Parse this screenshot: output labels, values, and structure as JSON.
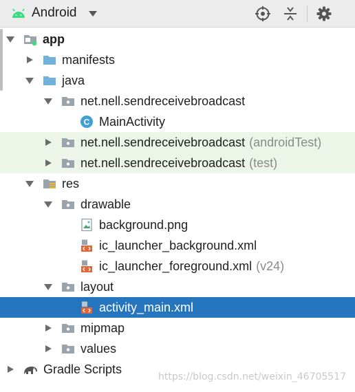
{
  "toolbar": {
    "view_label": "Android",
    "icons": [
      "android-icon",
      "dropdown-arrow-icon",
      "locate-icon",
      "collapse-all-icon",
      "settings-icon"
    ]
  },
  "tree": {
    "app": "app",
    "manifests": "manifests",
    "java": "java",
    "pkg_main": "net.nell.sendreceivebroadcast",
    "main_activity": "MainActivity",
    "main_activity_badge": "C",
    "pkg_android_test": "net.nell.sendreceivebroadcast",
    "pkg_android_test_suffix": "(androidTest)",
    "pkg_test": "net.nell.sendreceivebroadcast",
    "pkg_test_suffix": "(test)",
    "res": "res",
    "drawable": "drawable",
    "background_png": "background.png",
    "ic_launcher_background": "ic_launcher_background.xml",
    "ic_launcher_foreground": "ic_launcher_foreground.xml",
    "ic_launcher_foreground_suffix": "(v24)",
    "layout": "layout",
    "activity_main": "activity_main.xml",
    "mipmap": "mipmap",
    "values": "values",
    "gradle_scripts": "Gradle Scripts"
  },
  "selected_item": "activity_main.xml",
  "watermark": "https://blog.csdn.net/weixin_46705517",
  "colors": {
    "selection": "#2675bf",
    "test_highlight": "#edf5e9",
    "folder_blue": "#6fb2dc",
    "folder_grey": "#9aa4ad",
    "android_green": "#3ddc84",
    "class_icon": "#3f9fd6",
    "xml_icon": "#e0673a"
  }
}
